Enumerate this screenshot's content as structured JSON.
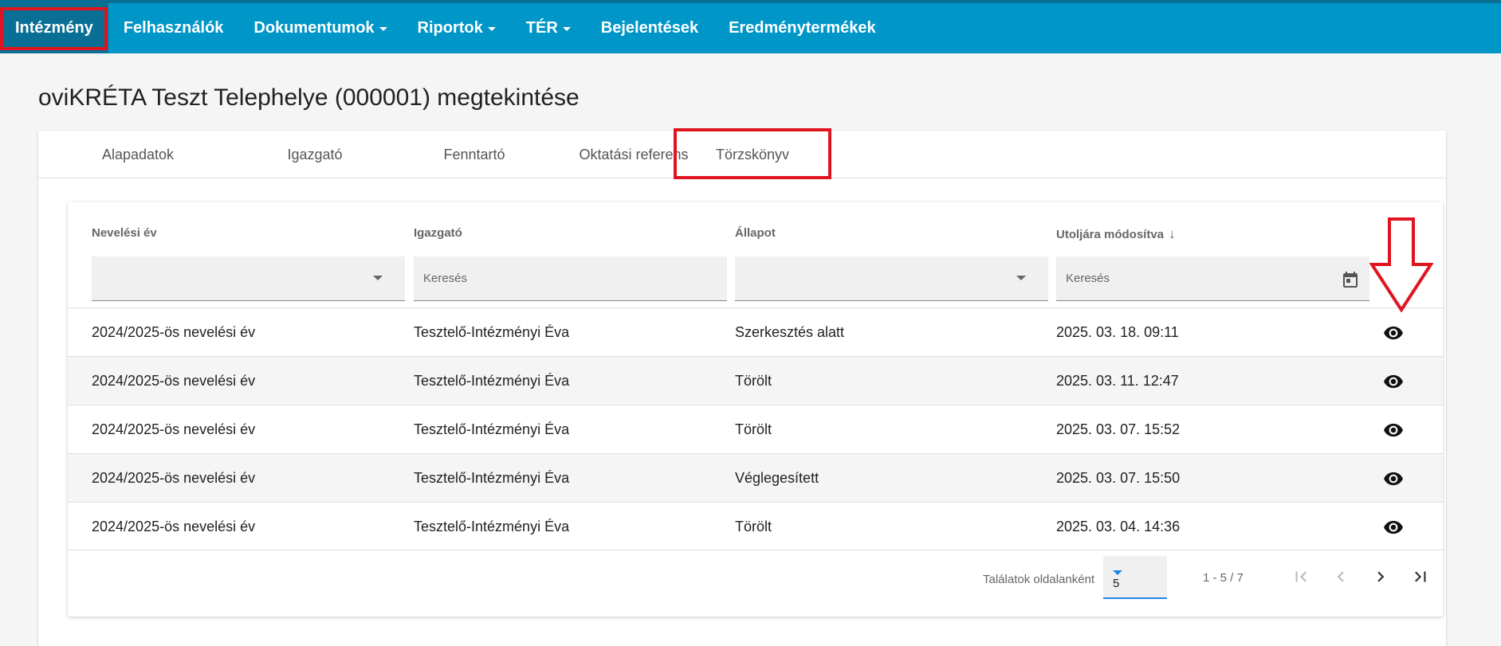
{
  "nav": {
    "items": [
      {
        "label": "Intézmény",
        "active": true,
        "dropdown": false
      },
      {
        "label": "Felhasználók",
        "dropdown": false
      },
      {
        "label": "Dokumentumok",
        "dropdown": true
      },
      {
        "label": "Riportok",
        "dropdown": true
      },
      {
        "label": "TÉR",
        "dropdown": true
      },
      {
        "label": "Bejelentések",
        "dropdown": false
      },
      {
        "label": "Eredménytermékek",
        "dropdown": false
      }
    ]
  },
  "page": {
    "title": "oviKRÉTA Teszt Telephelye (000001) megtekintése"
  },
  "tabs": [
    {
      "label": "Alapadatok"
    },
    {
      "label": "Igazgató"
    },
    {
      "label": "Fenntartó"
    },
    {
      "label": "Oktatási referens"
    },
    {
      "label": "Törzskönyv",
      "active": true
    }
  ],
  "table": {
    "headers": [
      "Nevelési év",
      "Igazgató",
      "Állapot",
      "Utoljára módosítva"
    ],
    "sort_column": "Utoljára módosítva",
    "sort_direction": "desc",
    "filters": {
      "igazgato_placeholder": "Keresés",
      "modositva_placeholder": "Keresés"
    },
    "rows": [
      {
        "ev": "2024/2025-ös nevelési év",
        "igazgato": "Tesztelő-Intézményi Éva",
        "allapot": "Szerkesztés alatt",
        "modositva": "2025. 03. 18. 09:11"
      },
      {
        "ev": "2024/2025-ös nevelési év",
        "igazgato": "Tesztelő-Intézményi Éva",
        "allapot": "Törölt",
        "modositva": "2025. 03. 11. 12:47"
      },
      {
        "ev": "2024/2025-ös nevelési év",
        "igazgato": "Tesztelő-Intézményi Éva",
        "allapot": "Törölt",
        "modositva": "2025. 03. 07. 15:52"
      },
      {
        "ev": "2024/2025-ös nevelési év",
        "igazgato": "Tesztelő-Intézményi Éva",
        "allapot": "Véglegesített",
        "modositva": "2025. 03. 07. 15:50"
      },
      {
        "ev": "2024/2025-ös nevelési év",
        "igazgato": "Tesztelő-Intézményi Éva",
        "allapot": "Törölt",
        "modositva": "2025. 03. 04. 14:36"
      }
    ]
  },
  "pagination": {
    "per_page_label": "Találatok oldalanként",
    "per_page_value": "5",
    "range": "1 - 5 / 7"
  },
  "colors": {
    "navbar": "#0096c7",
    "highlight": "#e0141e",
    "accent": "#1e88e5"
  }
}
